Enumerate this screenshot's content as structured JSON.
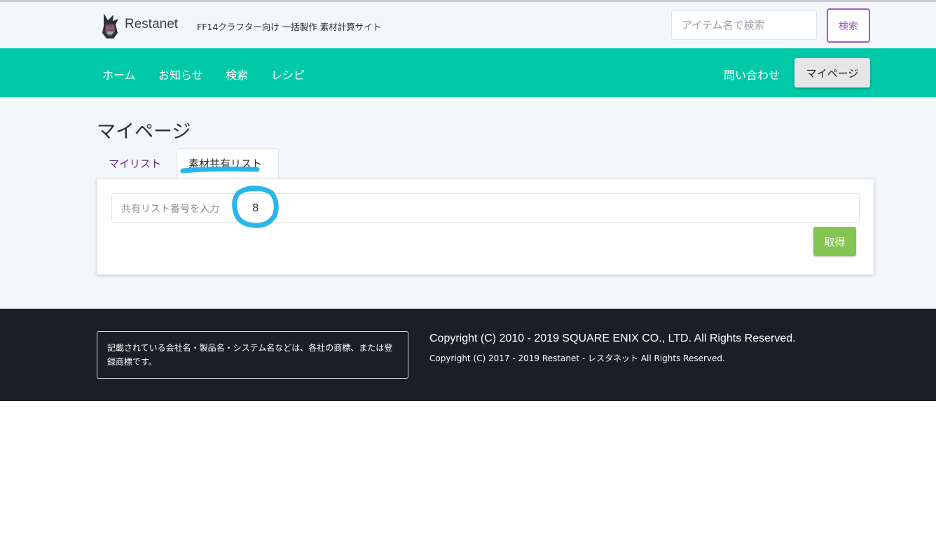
{
  "header": {
    "brand": "Restanet",
    "tagline": "FF14クラフター向け 一括製作 素材計算サイト",
    "search_placeholder": "アイテム名で検索",
    "search_button": "検索"
  },
  "nav": {
    "items": [
      "ホーム",
      "お知らせ",
      "検索",
      "レシピ"
    ],
    "contact": "問い合わせ",
    "mypage": "マイページ"
  },
  "main": {
    "title": "マイページ",
    "tabs": [
      "マイリスト",
      "素材共有リスト"
    ],
    "input_addon": "共有リスト番号を入力",
    "input_value": "8",
    "get_button": "取得"
  },
  "footer": {
    "notice": "記載されている会社名・製品名・システム名などは、各社の商標、または登録商標です。",
    "copyright1": "Copyright (C) 2010 - 2019 SQUARE ENIX CO., LTD. All Rights Reserved.",
    "copyright2": "Copyright (C) 2017 - 2019 Restanet - レスタネット All Rights Reserved."
  },
  "colors": {
    "nav_bg": "#00c9a7",
    "search_accent": "#9b51c0",
    "get_button": "#84c451",
    "footer_bg": "#1b1e24",
    "annotation": "#29b6e8"
  }
}
